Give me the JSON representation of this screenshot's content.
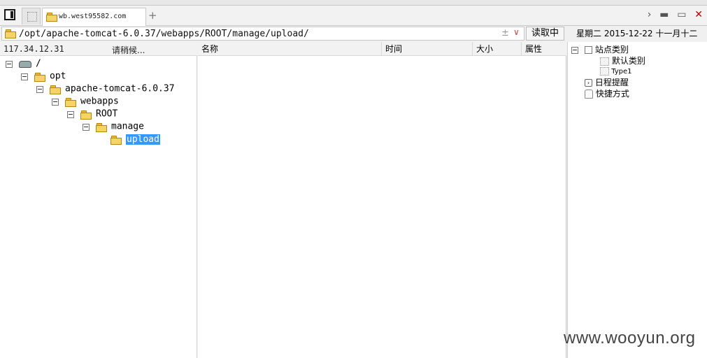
{
  "tabs": {
    "active_label": "wb.west95582.com",
    "new_tab_symbol": "+"
  },
  "window_controls": {
    "forward": "›",
    "minimize": "▬",
    "maximize": "▭",
    "close": "✕"
  },
  "address_bar": {
    "path": "/opt/apache-tomcat-6.0.37/webapps/ROOT/manage/upload/",
    "pm_symbol": "±",
    "dropdown_symbol": "∨",
    "read_button": "读取中"
  },
  "date_bar": "星期二 2015-12-22 十一月十二",
  "left_pane": {
    "host": "117.34.12.31",
    "status": "请稍候...",
    "tree": [
      {
        "label": "/",
        "icon": "drive-icon",
        "depth": 0
      },
      {
        "label": "opt",
        "icon": "folder-icon",
        "depth": 1
      },
      {
        "label": "apache-tomcat-6.0.37",
        "icon": "folder-icon",
        "depth": 2
      },
      {
        "label": "webapps",
        "icon": "folder-icon",
        "depth": 3
      },
      {
        "label": "ROOT",
        "icon": "folder-icon",
        "depth": 4
      },
      {
        "label": "manage",
        "icon": "folder-icon",
        "depth": 5
      },
      {
        "label": "upload",
        "icon": "folder-icon",
        "depth": 6,
        "selected": true
      }
    ]
  },
  "file_list": {
    "columns": [
      "名称",
      "时间",
      "大小",
      "属性"
    ],
    "rows": []
  },
  "right_pane": {
    "site_category": "站点类别",
    "default_category": "默认类别",
    "type1": "Type1",
    "schedule": "日程提醒",
    "shortcuts": "快捷方式"
  },
  "watermark": "www.wooyun.org",
  "colors": {
    "selection": "#3399ff",
    "close": "#c00000",
    "folder": "#f6d365"
  }
}
